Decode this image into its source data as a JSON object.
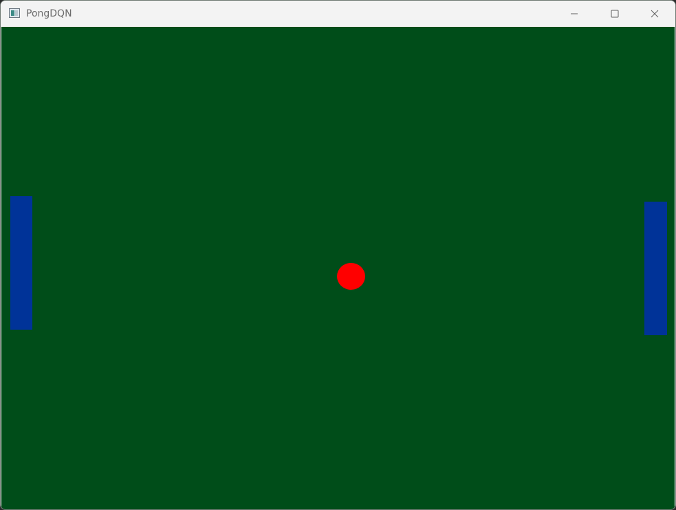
{
  "window": {
    "title": "PongDQN",
    "icons": {
      "app": "app-window-icon",
      "minimize": "minimize-icon",
      "maximize": "maximize-icon",
      "close": "close-icon"
    }
  },
  "game": {
    "colors": {
      "field": "#004d19",
      "paddle": "#003398",
      "ball": "#ff0000"
    }
  }
}
